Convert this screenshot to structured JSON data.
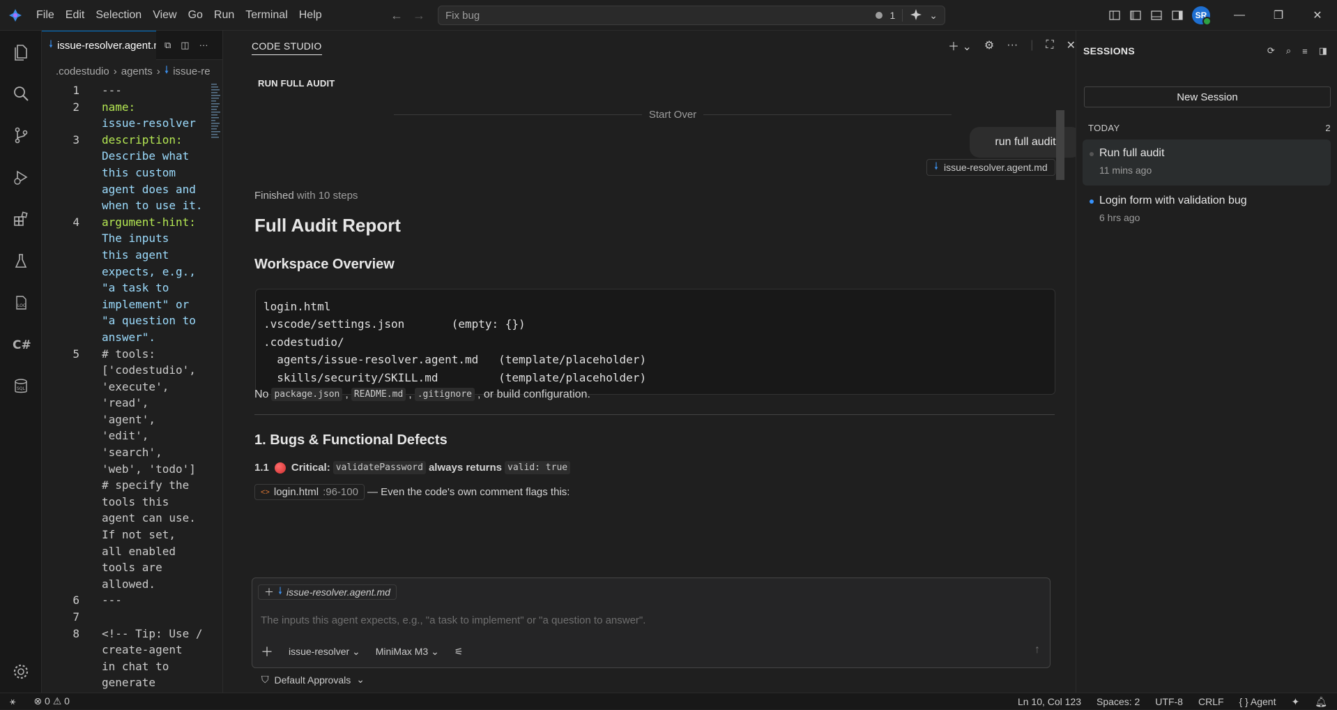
{
  "menu": [
    "File",
    "Edit",
    "Selection",
    "View",
    "Go",
    "Run",
    "Terminal",
    "Help"
  ],
  "command_center": {
    "text": "Fix bug",
    "count": "1"
  },
  "avatar": {
    "initials": "SR"
  },
  "editor": {
    "tab_label": "issue-resolver.agent.md",
    "breadcrumb": [
      ".codestudio",
      "agents",
      "issue-re"
    ],
    "line_numbers": [
      "1",
      "2",
      "",
      "3",
      "",
      "",
      "",
      "4",
      "",
      "",
      "",
      "",
      "",
      "",
      "5",
      "",
      "",
      "",
      "",
      "",
      "",
      "",
      "",
      "",
      "",
      "",
      "",
      "",
      "",
      "6",
      "7",
      "8",
      "",
      "",
      ""
    ],
    "lines": [
      "---",
      "name:",
      "issue-resolver",
      "description:",
      "Describe what",
      "this custom",
      "agent does and",
      "when to use it.",
      "argument-hint:",
      "The inputs",
      "this agent",
      "expects, e.g.,",
      "\"a task to",
      "implement\" or",
      "\"a question to",
      "answer\".",
      "# tools:",
      "['codestudio',",
      "'execute',",
      "'read',",
      "'agent',",
      "'edit',",
      "'search',",
      "'web', 'todo']",
      "# specify the",
      "tools this",
      "agent can use.",
      "If not set,",
      "all enabled",
      "tools are",
      "allowed.",
      "---",
      "",
      "<!-- Tip: Use /",
      "create-agent",
      "in chat to",
      "generate"
    ]
  },
  "chat": {
    "panel_title": "CODE STUDIO",
    "session_title": "RUN FULL AUDIT",
    "start_over": "Start Over",
    "user_message": "run full audit",
    "attached_file": "issue-resolver.agent.md",
    "finished_prefix": "Finished",
    "finished_suffix": "with 10 steps",
    "report_title": "Full Audit Report",
    "workspace_heading": "Workspace Overview",
    "workspace_tree": "login.html\n.vscode/settings.json       (empty: {})\n.codestudio/\n  agents/issue-resolver.agent.md   (template/placeholder)\n  skills/security/SKILL.md         (template/placeholder)",
    "no_files": {
      "prefix": "No",
      "files": [
        "package.json",
        "README.md",
        ".gitignore"
      ],
      "suffix": ", or build configuration."
    },
    "bugs_heading": "1. Bugs & Functional Defects",
    "bug_1": {
      "number": "1.1",
      "severity": "Critical:",
      "fn": "validatePassword",
      "text": "always returns",
      "value": "valid: true"
    },
    "ref": {
      "file": "login.html",
      "lines": ":96-100",
      "text": "— Even the code's own comment flags this:"
    },
    "input": {
      "chip": "issue-resolver.agent.md",
      "placeholder": "The inputs this agent expects, e.g., \"a task to implement\" or \"a question to answer\".",
      "agent": "issue-resolver",
      "model": "MiniMax M3",
      "approvals": "Default Approvals"
    }
  },
  "sessions": {
    "title": "SESSIONS",
    "new_session": "New Session",
    "group": "TODAY",
    "group_count": "2",
    "items": [
      {
        "name": "Run full audit",
        "time": "11 mins ago"
      },
      {
        "name": "Login form with validation bug",
        "time": "6 hrs ago"
      }
    ]
  },
  "statusbar": {
    "errors": "0",
    "warnings": "0",
    "position": "Ln 10, Col 123",
    "spaces": "Spaces: 2",
    "encoding": "UTF-8",
    "eol": "CRLF",
    "language": "{ } Agent"
  },
  "colors": {
    "accent": "#0078d4",
    "critical": "#e5484d",
    "session_dot": "#3794ff"
  }
}
